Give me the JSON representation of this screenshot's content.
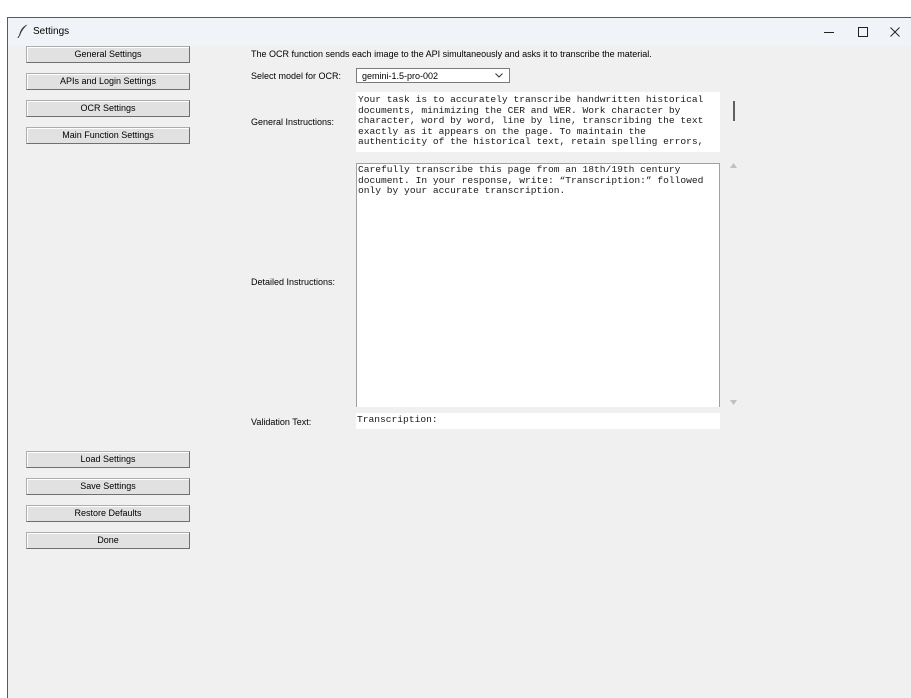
{
  "window": {
    "title": "Settings",
    "icon": "feather-icon",
    "controls": [
      "minimize-icon",
      "maximize-icon",
      "close-icon"
    ]
  },
  "sidebar": {
    "top_buttons": [
      {
        "label": "General Settings"
      },
      {
        "label": "APIs and Login Settings"
      },
      {
        "label": "OCR Settings"
      },
      {
        "label": "Main Function Settings"
      }
    ],
    "bottom_buttons": [
      {
        "label": "Load Settings"
      },
      {
        "label": "Save Settings"
      },
      {
        "label": "Restore Defaults"
      },
      {
        "label": "Done"
      }
    ]
  },
  "main": {
    "description": "The OCR function sends each image to the API simultaneously and asks it to transcribe the material.",
    "model": {
      "label": "Select model for OCR:",
      "value": "gemini-1.5-pro-002"
    },
    "general_instructions": {
      "label": "General Instructions:",
      "text": "Your task is to accurately transcribe handwritten historical\ndocuments, minimizing the CER and WER. Work character by\ncharacter, word by word, line by line, transcribing the text\nexactly as it appears on the page. To maintain the\nauthenticity of the historical text, retain spelling errors,"
    },
    "detailed_instructions": {
      "label": "Detailed Instructions:",
      "text": "Carefully transcribe this page from an 18th/19th century\ndocument. In your response, write: “Transcription:” followed\nonly by your accurate transcription."
    },
    "validation": {
      "label": "Validation Text:",
      "value": "Transcription:"
    }
  },
  "colors": {
    "window_bg": "#f0f0f0",
    "titlebar_bg": "#f0f4f9",
    "button_bg": "#e1e1e1"
  }
}
